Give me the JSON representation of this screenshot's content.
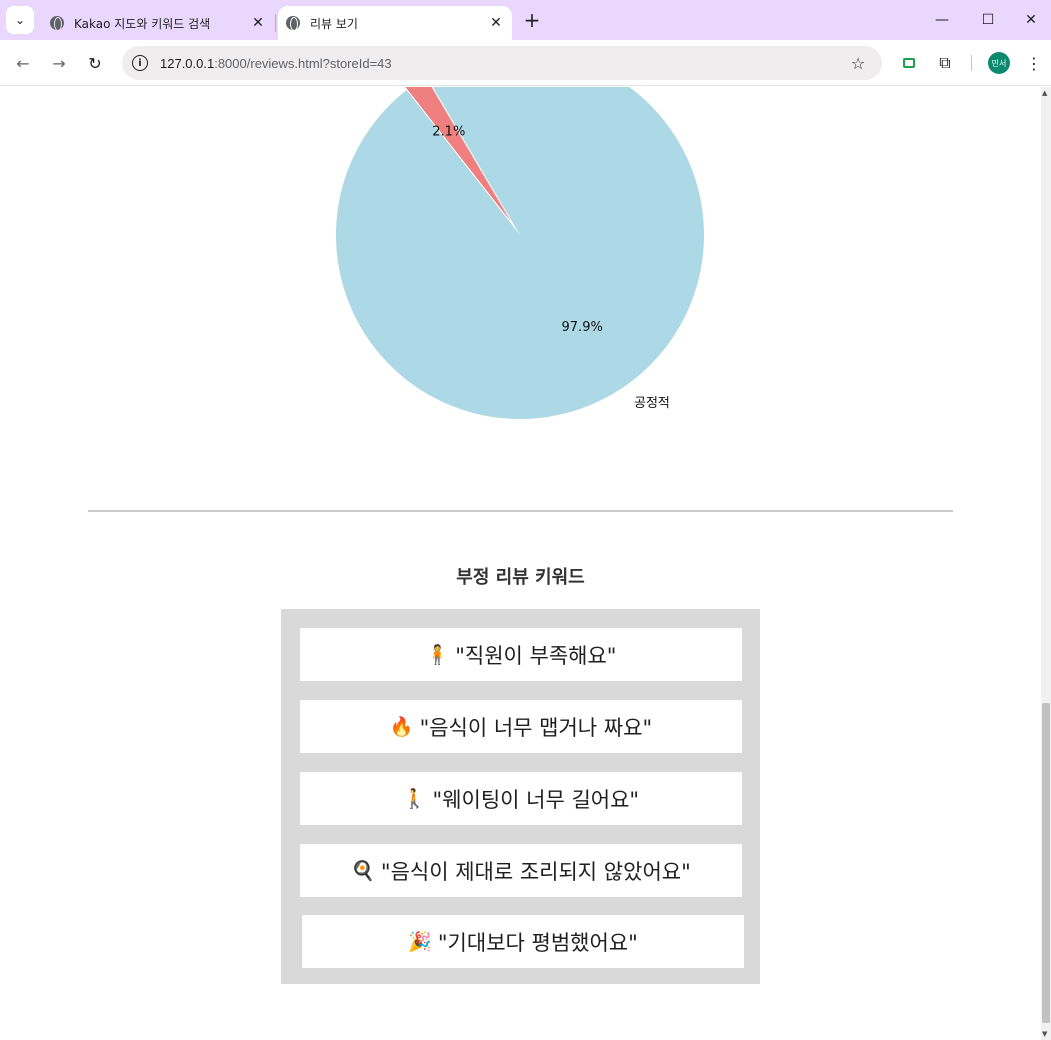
{
  "browser": {
    "tabs": [
      {
        "title": "Kakao 지도와 키워드 검색",
        "active": false
      },
      {
        "title": "리뷰 보기",
        "active": true
      }
    ],
    "url_host": "127.0.0.1",
    "url_rest": ":8000/reviews.html?storeId=43",
    "profile_initials": "민서"
  },
  "chart_data": {
    "type": "pie",
    "slices": [
      {
        "label": "공정적",
        "value": 97.9,
        "pct_label": "97.9%",
        "color": "#add8e6"
      },
      {
        "label": "",
        "value": 2.1,
        "pct_label": "2.1%",
        "color": "#f08080"
      }
    ]
  },
  "negative_section": {
    "title": "부정 리뷰 키워드",
    "keywords": [
      {
        "emoji": "🧍",
        "text": "\"직원이 부족해요\""
      },
      {
        "emoji": "🔥",
        "text": "\"음식이 너무 맵거나 짜요\""
      },
      {
        "emoji": "🚶",
        "text": "\"웨이팅이 너무 길어요\""
      },
      {
        "emoji": "🍳",
        "text": "\"음식이 제대로 조리되지 않았어요\""
      },
      {
        "emoji": "🎉",
        "text": "\"기대보다 평범했어요\""
      }
    ]
  }
}
